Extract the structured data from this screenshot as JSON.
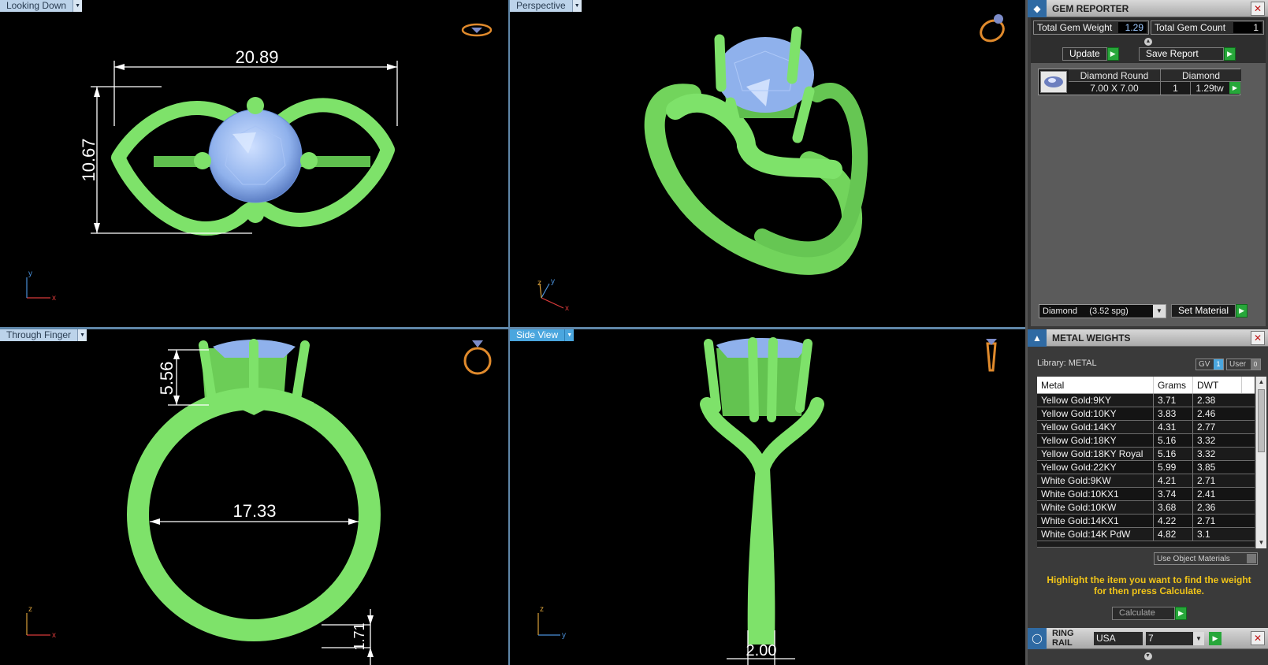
{
  "viewports": {
    "top_left": {
      "label": "Looking Down",
      "dims": {
        "width": "20.89",
        "height": "10.67"
      },
      "axes": {
        "x": "x",
        "y": "y"
      }
    },
    "top_right": {
      "label": "Perspective",
      "axes": {
        "x": "x",
        "y": "y",
        "z": "z"
      }
    },
    "bottom_left": {
      "label": "Through Finger",
      "dims": {
        "setting_height": "5.56",
        "inner_diameter": "17.33",
        "shank": "1.71"
      },
      "axes": {
        "x": "x",
        "z": "z"
      }
    },
    "bottom_right": {
      "label": "Side View",
      "dims": {
        "bottom_width": "2.00"
      },
      "axes": {
        "y": "y",
        "z": "z"
      }
    }
  },
  "gem_reporter": {
    "title": "GEM REPORTER",
    "total_gem_weight_label": "Total Gem Weight",
    "total_gem_weight": "1.29",
    "total_gem_count_label": "Total Gem Count",
    "total_gem_count": "1",
    "update_label": "Update",
    "save_report_label": "Save Report",
    "gem": {
      "shape": "Diamond Round",
      "size": "7.00 X 7.00",
      "material": "Diamond",
      "count": "1",
      "weight": "1.29tw"
    },
    "material_select": "Diamond     (3.52 spg)",
    "set_material_label": "Set Material"
  },
  "metal_weights": {
    "title": "METAL WEIGHTS",
    "library_label": "Library: METAL",
    "gv_label": "GV",
    "user_label": "User",
    "columns": [
      "Metal",
      "Grams",
      "DWT"
    ],
    "rows": [
      [
        "Yellow Gold:9KY",
        "3.71",
        "2.38"
      ],
      [
        "Yellow Gold:10KY",
        "3.83",
        "2.46"
      ],
      [
        "Yellow Gold:14KY",
        "4.31",
        "2.77"
      ],
      [
        "Yellow Gold:18KY",
        "5.16",
        "3.32"
      ],
      [
        "Yellow Gold:18KY Royal",
        "5.16",
        "3.32"
      ],
      [
        "Yellow Gold:22KY",
        "5.99",
        "3.85"
      ],
      [
        "White Gold:9KW",
        "4.21",
        "2.71"
      ],
      [
        "White Gold:10KX1",
        "3.74",
        "2.41"
      ],
      [
        "White Gold:10KW",
        "3.68",
        "2.36"
      ],
      [
        "White Gold:14KX1",
        "4.22",
        "2.71"
      ],
      [
        "White Gold:14K PdW",
        "4.82",
        "3.1"
      ]
    ],
    "use_object_materials_label": "Use Object Materials",
    "hint": "Highlight the item you want to find the weight for then press Calculate.",
    "calculate_label": "Calculate"
  },
  "ring_rail": {
    "title": "RING RAIL",
    "standard": "USA",
    "size": "7"
  },
  "colors": {
    "ring_green": "#7ee26a",
    "gem_blue": "#8fb1ec",
    "dimension_white": "#ffffff",
    "hint_yellow": "#f0c419",
    "go_green": "#27a73a"
  }
}
